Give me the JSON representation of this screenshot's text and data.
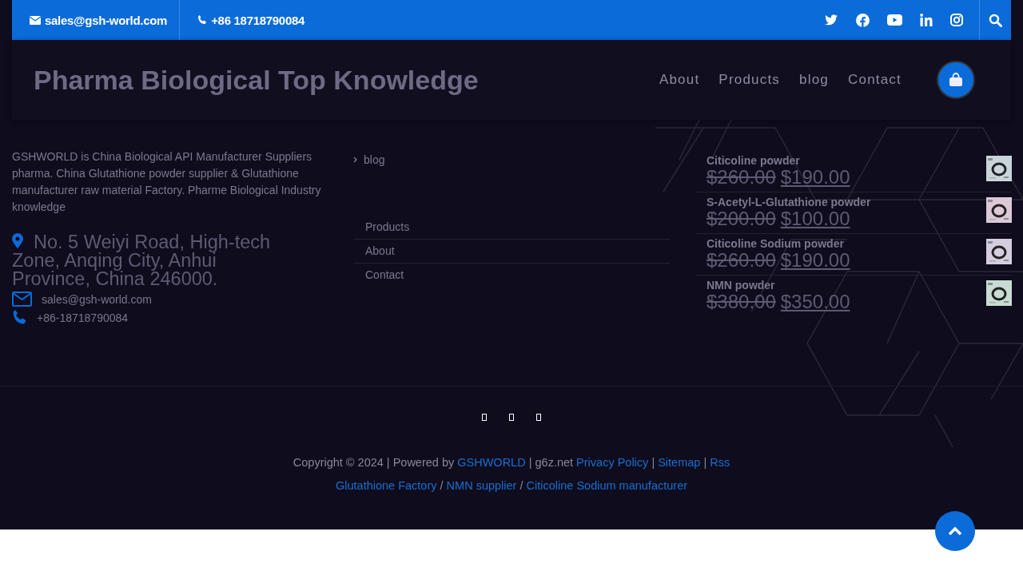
{
  "topbar": {
    "email": "sales@gsh-world.com",
    "phone": "+86 18718790084",
    "social": [
      {
        "kind": "twitter"
      },
      {
        "kind": "facebook"
      },
      {
        "kind": "youtube"
      },
      {
        "kind": "linkedin"
      },
      {
        "kind": "instagram"
      }
    ]
  },
  "header": {
    "site_title": "Pharma Biological Top Knowledge",
    "nav": [
      "About",
      "Products",
      "blog",
      "Contact"
    ]
  },
  "about": {
    "text": "GSHWORLD is China Biological API Manufacturer Suppliers pharma. China Glutathione powder supplier & Glutathione manufacturer raw material Factory. Pharme Biological Industry knowledge",
    "address": "No. 5 Weiyi Road, High-tech Zone, Anqing City, Anhui Province, China 246000.",
    "email": "sales@gsh-world.com",
    "phone": "+86-18718790084"
  },
  "categories": {
    "items": [
      "blog"
    ],
    "pages": [
      "Products",
      "About",
      "Contact"
    ]
  },
  "products": [
    {
      "name": "Citicoline powder",
      "old_price": "$260.00",
      "price": "$190.00",
      "color": "#c8d6dc"
    },
    {
      "name": "S-Acetyl-L-Glutathione powder",
      "old_price": "$200.00",
      "price": "$100.00",
      "color": "#dcc8d6"
    },
    {
      "name": "Citicoline Sodium powder",
      "old_price": "$260.00",
      "price": "$190.00",
      "color": "#d6cce0"
    },
    {
      "name": "NMN powder",
      "old_price": "$380.00",
      "price": "$350.00",
      "color": "#c8dcd2"
    }
  ],
  "footer_icons": [
    {
      "kind": "glyph"
    },
    {
      "kind": "glyph"
    },
    {
      "kind": "glyph"
    }
  ],
  "copyright": [
    {
      "kind": "text",
      "text": "Copyright © 2024 | Powered by"
    },
    {
      "kind": "link",
      "text": "GSHWORLD"
    },
    {
      "kind": "text",
      "text": "| g6z.net"
    },
    {
      "kind": "link",
      "text": "Privacy Policy"
    },
    {
      "kind": "text",
      "text": "|"
    },
    {
      "kind": "link",
      "text": "Sitemap"
    },
    {
      "kind": "text",
      "text": "|"
    },
    {
      "kind": "link",
      "text": "Rss"
    }
  ],
  "links": [
    {
      "kind": "link",
      "text": "Glutathione Factory"
    },
    {
      "kind": "text",
      "text": "/"
    },
    {
      "kind": "link",
      "text": "NMN supplier"
    },
    {
      "kind": "text",
      "text": "/"
    },
    {
      "kind": "link",
      "text": "Citicoline Sodium manufacturer"
    }
  ]
}
